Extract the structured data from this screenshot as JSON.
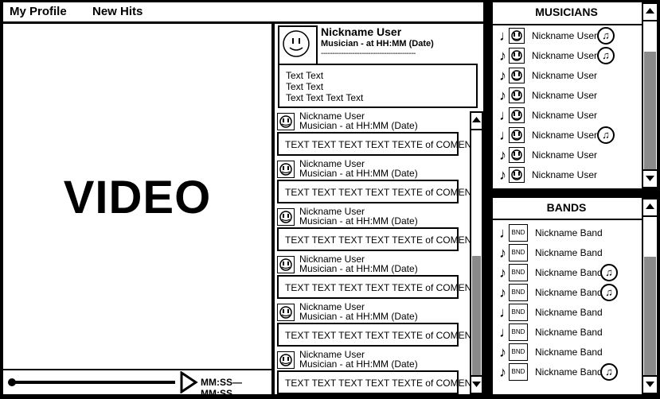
{
  "nav": {
    "my_profile": "My Profile",
    "new_hits": "New Hits"
  },
  "video": {
    "label": "VIDEO",
    "time": "MM:SS—MM:SS"
  },
  "post": {
    "nickname": "Nickname User",
    "meta": "Musician - at HH:MM (Date)",
    "divider": "------------------------------------------",
    "lines": [
      "Text Text",
      "Text Text",
      "Text Text Text Text"
    ]
  },
  "comments": [
    {
      "name": "Nickname User",
      "meta": "Musician - at HH:MM (Date)",
      "text": "TEXT TEXT TEXT TEXT TEXTE of COMENT"
    },
    {
      "name": "Nickname User",
      "meta": "Musician - at HH:MM (Date)",
      "text": "TEXT TEXT TEXT TEXT TEXTE of COMENT"
    },
    {
      "name": "Nickname User",
      "meta": "Musician - at HH:MM (Date)",
      "text": "TEXT TEXT TEXT TEXT TEXTE of COMENT"
    },
    {
      "name": "Nickname User",
      "meta": "Musician - at HH:MM (Date)",
      "text": "TEXT TEXT TEXT TEXT TEXTE of COMENT"
    },
    {
      "name": "Nickname User",
      "meta": "Musician - at HH:MM (Date)",
      "text": "TEXT TEXT TEXT TEXT TEXTE of COMENT"
    },
    {
      "name": "Nickname User",
      "meta": "Musician - at HH:MM (Date)",
      "text": "TEXT TEXT TEXT TEXT TEXTE of COMENT"
    }
  ],
  "musicians": {
    "title": "MUSICIANS",
    "items": [
      {
        "name": "Nickname User",
        "icon": "single-note",
        "has_music": true
      },
      {
        "name": "Nickname User",
        "icon": "eighth-note",
        "has_music": true
      },
      {
        "name": "Nickname User",
        "icon": "eighth-note",
        "has_music": false
      },
      {
        "name": "Nickname User",
        "icon": "eighth-note",
        "has_music": false
      },
      {
        "name": "Nickname User",
        "icon": "single-note",
        "has_music": false
      },
      {
        "name": "Nickname User",
        "icon": "single-note",
        "has_music": true
      },
      {
        "name": "Nickname User",
        "icon": "eighth-note",
        "has_music": false
      },
      {
        "name": "Nickname User",
        "icon": "eighth-note",
        "has_music": false
      }
    ]
  },
  "bands": {
    "title": "BANDS",
    "avatar_text": "BND",
    "items": [
      {
        "name": "Nickname Band",
        "icon": "single-note",
        "has_music": false
      },
      {
        "name": "Nickname Band",
        "icon": "eighth-note",
        "has_music": false
      },
      {
        "name": "Nickname Band",
        "icon": "eighth-note",
        "has_music": true
      },
      {
        "name": "Nickname Band",
        "icon": "eighth-note",
        "has_music": true
      },
      {
        "name": "Nickname Band",
        "icon": "single-note",
        "has_music": false
      },
      {
        "name": "Nickname Band",
        "icon": "single-note",
        "has_music": false
      },
      {
        "name": "Nickname Band",
        "icon": "eighth-note",
        "has_music": false
      },
      {
        "name": "Nickname Band",
        "icon": "eighth-note",
        "has_music": true
      }
    ]
  },
  "glyphs": {
    "single-note": "♩",
    "eighth-note": "♪",
    "music": "♫"
  }
}
